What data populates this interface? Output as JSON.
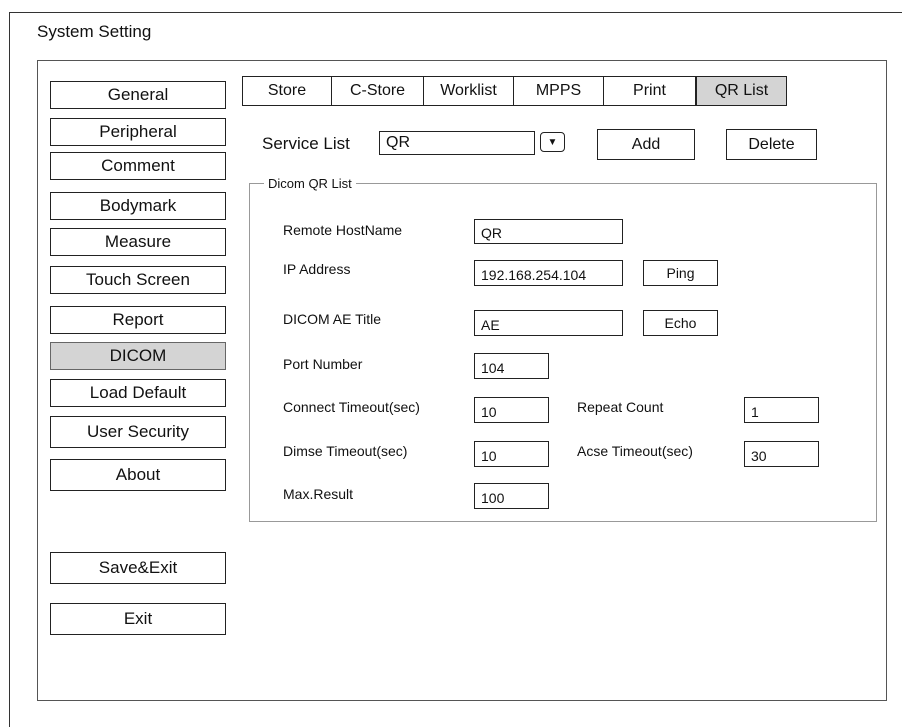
{
  "window": {
    "title": "System Setting"
  },
  "sidebar": {
    "items": [
      "General",
      "Peripheral",
      "Comment",
      "Bodymark",
      "Measure",
      "Touch Screen",
      "Report",
      "DICOM",
      "Load Default",
      "User Security",
      "About"
    ],
    "selected": "DICOM",
    "save_exit": "Save&Exit",
    "exit": "Exit"
  },
  "tabs": {
    "items": [
      "Store",
      "C-Store",
      "Worklist",
      "MPPS",
      "Print",
      "QR List"
    ],
    "selected": "QR List"
  },
  "service": {
    "label": "Service List",
    "value": "QR",
    "add": "Add",
    "delete": "Delete",
    "dropdown_icon": "▼"
  },
  "qr_group": {
    "legend": "Dicom QR List",
    "remote_hostname_label": "Remote HostName",
    "remote_hostname_value": "QR",
    "ip_label": "IP Address",
    "ip_value": "192.168.254.104",
    "ping": "Ping",
    "ae_label": "DICOM AE Title",
    "ae_value": "AE",
    "echo": "Echo",
    "port_label": "Port Number",
    "port_value": "104",
    "connect_timeout_label": "Connect Timeout(sec)",
    "connect_timeout_value": "10",
    "repeat_count_label": "Repeat Count",
    "repeat_count_value": "1",
    "dimse_timeout_label": "Dimse Timeout(sec)",
    "dimse_timeout_value": "10",
    "acse_timeout_label": "Acse Timeout(sec)",
    "acse_timeout_value": "30",
    "max_result_label": "Max.Result",
    "max_result_value": "100"
  },
  "colors": {
    "selected_bg": "#d4d4d4",
    "border": "#222222"
  }
}
